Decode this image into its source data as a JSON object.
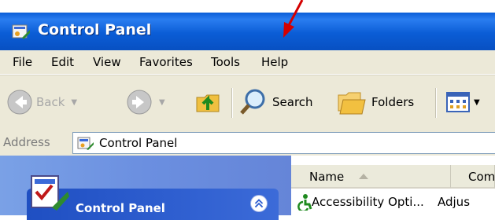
{
  "window": {
    "title": "Control Panel"
  },
  "menu": [
    "File",
    "Edit",
    "View",
    "Favorites",
    "Tools",
    "Help"
  ],
  "toolbar": {
    "back_label": "Back",
    "search_label": "Search",
    "folders_label": "Folders"
  },
  "address": {
    "label": "Address",
    "value": "Control Panel"
  },
  "taskpane": {
    "title": "Control Panel"
  },
  "filelist": {
    "columns": [
      "Name",
      "Comm"
    ],
    "rows": [
      {
        "name": "Accessibility Opti...",
        "comment": "Adjus"
      }
    ]
  },
  "colors": {
    "titlebar": "#0b5ed8",
    "menubar": "#ece9d8",
    "annotation_arrow": "#d40000",
    "taskpane": "#6b8fe0"
  },
  "icons": [
    "control-panel-icon",
    "back-arrow-icon",
    "forward-arrow-icon",
    "up-folder-icon",
    "search-icon",
    "folders-icon",
    "views-icon",
    "collapse-chevron-icon",
    "accessibility-icon"
  ]
}
